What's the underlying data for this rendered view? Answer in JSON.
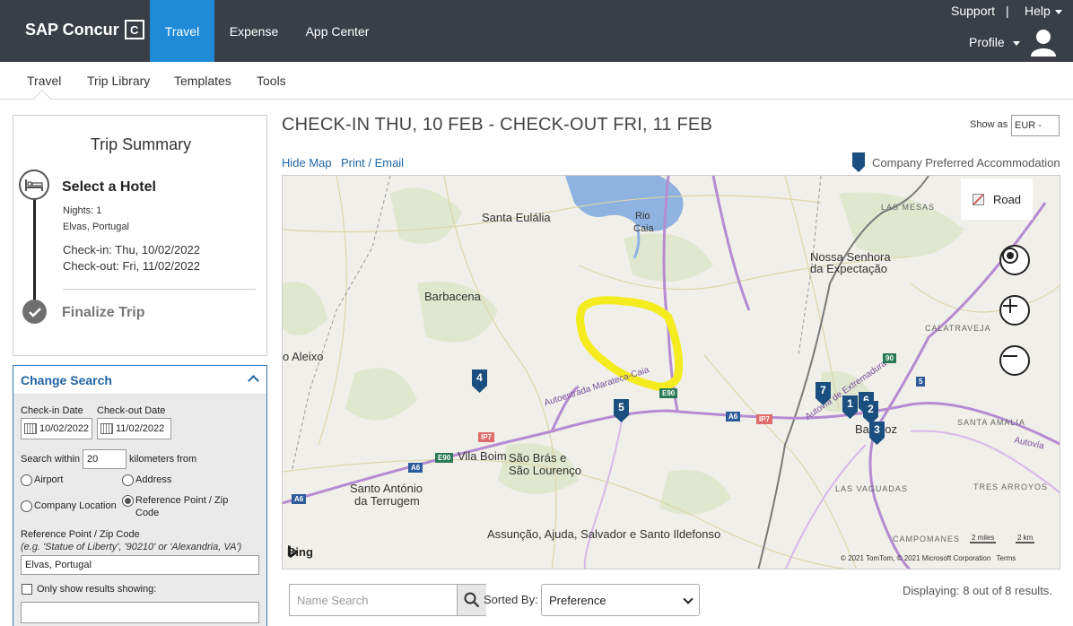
{
  "topbar": {
    "brand": "SAP Concur",
    "brand_mark": "C",
    "tabs": [
      {
        "label": "Travel",
        "active": true
      },
      {
        "label": "Expense",
        "active": false
      },
      {
        "label": "App Center",
        "active": false
      }
    ],
    "support": "Support",
    "separator": "|",
    "help": "Help",
    "profile": "Profile"
  },
  "subnav": {
    "items": [
      "Travel",
      "Trip Library",
      "Templates",
      "Tools"
    ]
  },
  "trip_summary": {
    "title": "Trip Summary",
    "step1": {
      "title": "Select a Hotel",
      "nights": "Nights: 1",
      "location": "Elvas, Portugal",
      "checkin": "Check-in: Thu, 10/02/2022",
      "checkout": "Check-out: Fri, 11/02/2022"
    },
    "step2": {
      "title": "Finalize Trip"
    }
  },
  "change_search": {
    "title": "Change Search",
    "checkin_label": "Check-in Date",
    "checkout_label": "Check-out Date",
    "checkin_value": "10/02/2022",
    "checkout_value": "11/02/2022",
    "search_within": "Search within",
    "distance": "20",
    "km_from": "kilometers from",
    "opt_airport": "Airport",
    "opt_address": "Address",
    "opt_company": "Company Location",
    "opt_reference_1": "Reference Point / Zip",
    "opt_reference_2": "Code",
    "ref_label": "Reference Point / Zip Code",
    "ref_hint": "(e.g. 'Statue of Liberty', '90210' or 'Alexandria, VA')",
    "ref_value": "Elvas, Portugal",
    "only_show": "Only show results showing:"
  },
  "main": {
    "heading": "CHECK-IN THU, 10 FEB - CHECK-OUT FRI, 11 FEB",
    "show_as": "Show as",
    "currency": "EUR -",
    "hide_map": "Hide Map",
    "print_email": "Print / Email",
    "company_pref": "Company Preferred Accommodation"
  },
  "map": {
    "road_button": "Road",
    "places": {
      "santa_eulalia": "Santa Eulália",
      "rio_caia_1": "Rio",
      "rio_caia_2": "Caia",
      "las_mesas": "LAS MESAS",
      "nossa_1": "Nossa Senhora",
      "nossa_2": "da Expectação",
      "barbacena": "Barbacena",
      "calatraveja": "CALATRAVEJA",
      "aleixo": "o Aleixo",
      "autoestrada": "Autoestrada Marateca-Caia",
      "autovia_ext": "Autovía de Extremadura",
      "santa_amalia": "SANTA AMALIA",
      "vila_boim": "Vila Boim",
      "sao_bras_1": "São Brás e",
      "sao_bras_2": "São Lourenço",
      "badajoz": "Badajoz",
      "tres_arroyos": "TRES ARROYOS",
      "santo_antonio_1": "Santo António",
      "santo_antonio_2": "da Terrugem",
      "las_vaguadas": "LAS VAGUADAS",
      "assuncao": "Assunção, Ajuda, Salvador e Santo Ildefonso",
      "campomanes": "CAMPOMANES",
      "autovia": "Autovía"
    },
    "shields": {
      "e90a": "E90",
      "e90b": "E90",
      "a6a": "A6",
      "a6b": "A6",
      "a6c": "A6",
      "ip7a": "IP7",
      "ip7b": "IP7",
      "n90": "90",
      "n5": "5"
    },
    "pins": [
      "1",
      "2",
      "3",
      "4",
      "5",
      "6",
      "7"
    ],
    "bing": "Bing",
    "scale_miles": "2 miles",
    "scale_km": "2 km",
    "copyright": "© 2021 TomTom, © 2021 Microsoft Corporation",
    "terms": "Terms"
  },
  "results_bar": {
    "name_search_placeholder": "Name Search",
    "sorted_by": "Sorted By:",
    "sort_value": "Preference",
    "displaying": "Displaying: 8 out of 8 results."
  },
  "colors": {
    "topbar": "#3a3f47",
    "active_tab": "#1f8ad8",
    "link": "#2064a3",
    "pin": "#1b4f7f",
    "highlight": "#f4ec1f"
  }
}
